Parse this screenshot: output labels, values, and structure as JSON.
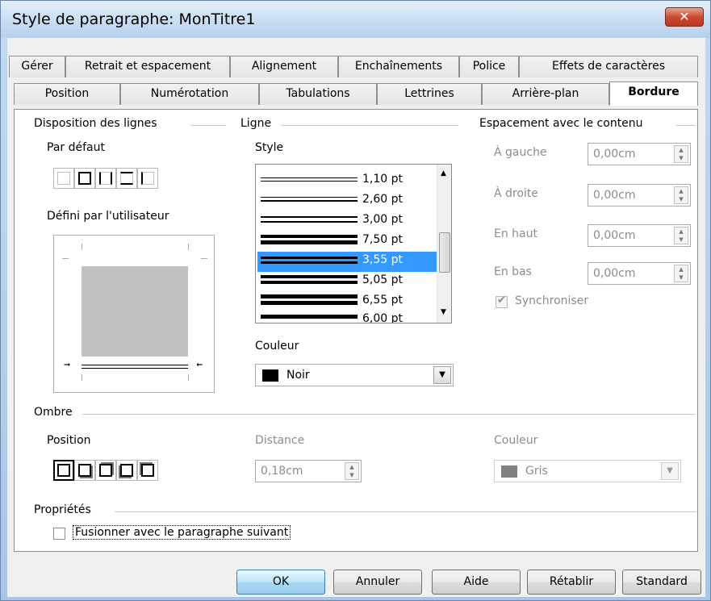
{
  "window": {
    "title": "Style de paragraphe: MonTitre1",
    "close_glyph": "✕"
  },
  "tabs": {
    "row1": [
      "Gérer",
      "Retrait et espacement",
      "Alignement",
      "Enchaînements",
      "Police",
      "Effets de caractères"
    ],
    "row2": [
      "Position",
      "Numérotation",
      "Tabulations",
      "Lettrines",
      "Arrière-plan",
      "Bordure"
    ],
    "active": "Bordure"
  },
  "line_arrangement": {
    "title": "Disposition des lignes",
    "default_label": "Par défaut",
    "user_defined_label": "Défini par l'utilisateur"
  },
  "line": {
    "title": "Ligne",
    "style_label": "Style",
    "styles": [
      "1,10 pt",
      "2,60 pt",
      "3,00 pt",
      "7,50 pt",
      "3,55 pt",
      "5,05 pt",
      "6,55 pt",
      "6,00 pt"
    ],
    "selected_style": "3,55 pt",
    "color_label": "Couleur",
    "color_value": "Noir",
    "color_swatch": "#000000"
  },
  "spacing": {
    "title": "Espacement avec le contenu",
    "left_label": "À gauche",
    "left_value": "0,00cm",
    "right_label": "À droite",
    "right_value": "0,00cm",
    "top_label": "En haut",
    "top_value": "0,00cm",
    "bottom_label": "En bas",
    "bottom_value": "0,00cm",
    "sync_label": "Synchroniser",
    "sync_checked": true
  },
  "shadow": {
    "title": "Ombre",
    "position_label": "Position",
    "distance_label": "Distance",
    "distance_value": "0,18cm",
    "color_label": "Couleur",
    "color_value": "Gris",
    "color_swatch": "#808080"
  },
  "properties": {
    "title": "Propriétés",
    "merge_label": "Fusionner avec le paragraphe suivant",
    "merge_checked": false
  },
  "buttons": {
    "ok": "OK",
    "cancel": "Annuler",
    "help": "Aide",
    "reset": "Rétablir",
    "standard": "Standard"
  }
}
